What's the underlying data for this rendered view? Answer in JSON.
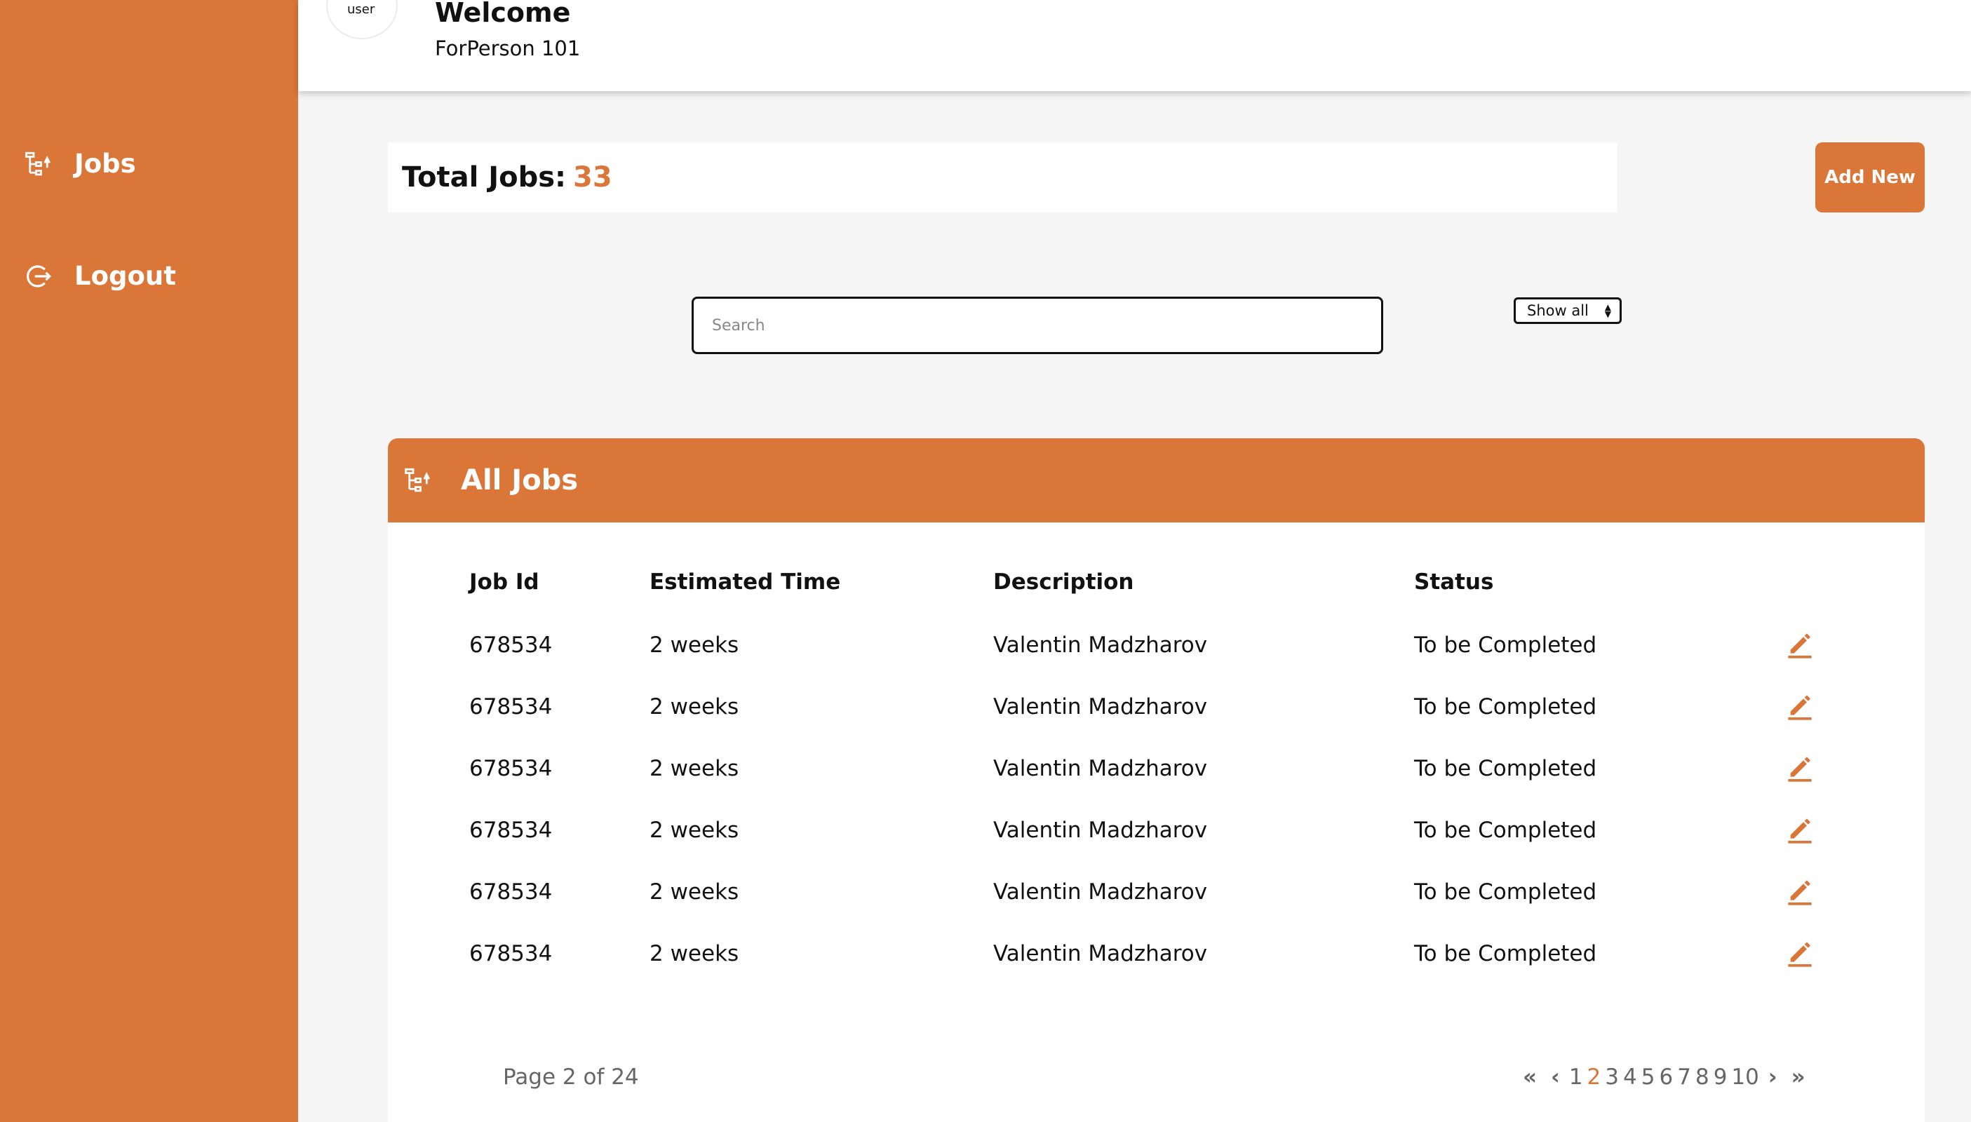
{
  "sidebar": {
    "items": [
      {
        "label": "Jobs",
        "icon": "jobs-hierarchy-icon"
      },
      {
        "label": "Logout",
        "icon": "logout-icon"
      }
    ],
    "bg_color": "#d97638"
  },
  "header": {
    "avatar_text": "user",
    "welcome": "Welcome",
    "person": "ForPerson 101"
  },
  "summary": {
    "total_label": "Total Jobs:",
    "total_value": "33",
    "add_button": "Add New"
  },
  "search": {
    "placeholder": "Search",
    "value": ""
  },
  "filter": {
    "selected": "Show all"
  },
  "jobs_panel": {
    "title": "All Jobs",
    "icon": "jobs-hierarchy-icon",
    "columns": [
      "Job Id",
      "Estimated Time",
      "Description",
      "Status"
    ],
    "rows": [
      {
        "id": "678534",
        "time": "2 weeks",
        "description": "Valentin Madzharov",
        "status": "To be Completed"
      },
      {
        "id": "678534",
        "time": "2 weeks",
        "description": "Valentin Madzharov",
        "status": "To be Completed"
      },
      {
        "id": "678534",
        "time": "2 weeks",
        "description": "Valentin Madzharov",
        "status": "To be Completed"
      },
      {
        "id": "678534",
        "time": "2 weeks",
        "description": "Valentin Madzharov",
        "status": "To be Completed"
      },
      {
        "id": "678534",
        "time": "2 weeks",
        "description": "Valentin Madzharov",
        "status": "To be Completed"
      },
      {
        "id": "678534",
        "time": "2 weeks",
        "description": "Valentin Madzharov",
        "status": "To be Completed"
      }
    ],
    "row_action_icon": "edit-pencil-icon"
  },
  "pagination": {
    "info": "Page 2 of 24",
    "pages": [
      "1",
      "2",
      "3",
      "4",
      "5",
      "6",
      "7",
      "8",
      "9",
      "10"
    ],
    "current": "2"
  },
  "accent_color": "#d97638"
}
